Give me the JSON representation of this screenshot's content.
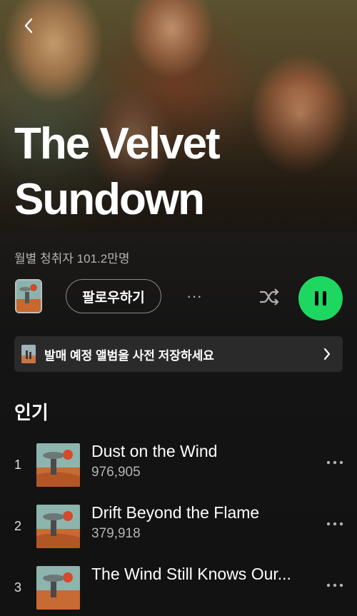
{
  "header": {
    "artist_name_line1": "The Velvet",
    "artist_name_line2": "Sundown",
    "back_icon": "chevron-left-icon"
  },
  "stats": {
    "monthly_listeners": "월별 청취자 101.2만명"
  },
  "actions": {
    "follow_label": "팔로우하기",
    "more_label": "···",
    "shuffle_icon": "shuffle-icon",
    "play_icon": "pause-icon",
    "accent_color": "#1ed760"
  },
  "presave": {
    "label": "발매 예정 앨범을 사전 저장하세요"
  },
  "popular": {
    "title": "인기",
    "tracks": [
      {
        "rank": "1",
        "title": "Dust on the Wind",
        "plays": "976,905"
      },
      {
        "rank": "2",
        "title": "Drift Beyond the Flame",
        "plays": "379,918"
      },
      {
        "rank": "3",
        "title": "The Wind Still Knows Our...",
        "plays": ""
      }
    ]
  }
}
